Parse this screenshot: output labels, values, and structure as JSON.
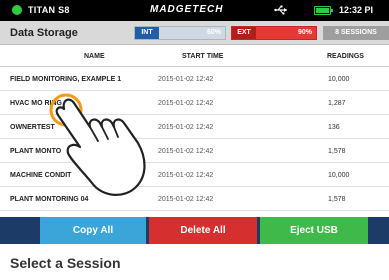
{
  "status": {
    "device": "TITAN S8",
    "brand": "MADGETECH",
    "time": "12:32 PI"
  },
  "header": {
    "title": "Data Storage",
    "int_label": "INT",
    "int_pct": "60%",
    "ext_label": "EXT",
    "ext_pct": "90%",
    "sessions": "8 SESSIONS"
  },
  "table": {
    "columns": [
      "NAME",
      "START TIME",
      "READINGS"
    ],
    "rows": [
      {
        "name": "FIELD MONITORING, EXAMPLE 1",
        "start": "2015-01-02 12:42",
        "readings": "10,000"
      },
      {
        "name": "HVAC MO          RING 02",
        "start": "2015-01-02 12:42",
        "readings": "1,287"
      },
      {
        "name": "OWNERTEST",
        "start": "2015-01-02 12:42",
        "readings": "136"
      },
      {
        "name": "PLANT MONTO",
        "start": "2015-01-02 12:42",
        "readings": "1,578"
      },
      {
        "name": "MACHINE CONDIT",
        "start": "2015-01-02 12:42",
        "readings": "10,000"
      },
      {
        "name": "PLANT MONTORING 04",
        "start": "2015-01-02 12:42",
        "readings": "1,578"
      }
    ]
  },
  "buttons": {
    "copy": "Copy All",
    "delete": "Delete All",
    "eject": "Eject USB"
  },
  "caption": "Select a Session",
  "colors": {
    "copy": "#3ba5d9",
    "delete": "#d62f2f",
    "eject": "#3fb94a",
    "int": "#1f5fa8",
    "ext": "#e53935"
  },
  "icons": {
    "usb": "usb-icon",
    "battery": "battery-icon",
    "status": "status-dot-icon",
    "hand": "pointing-hand-icon"
  }
}
